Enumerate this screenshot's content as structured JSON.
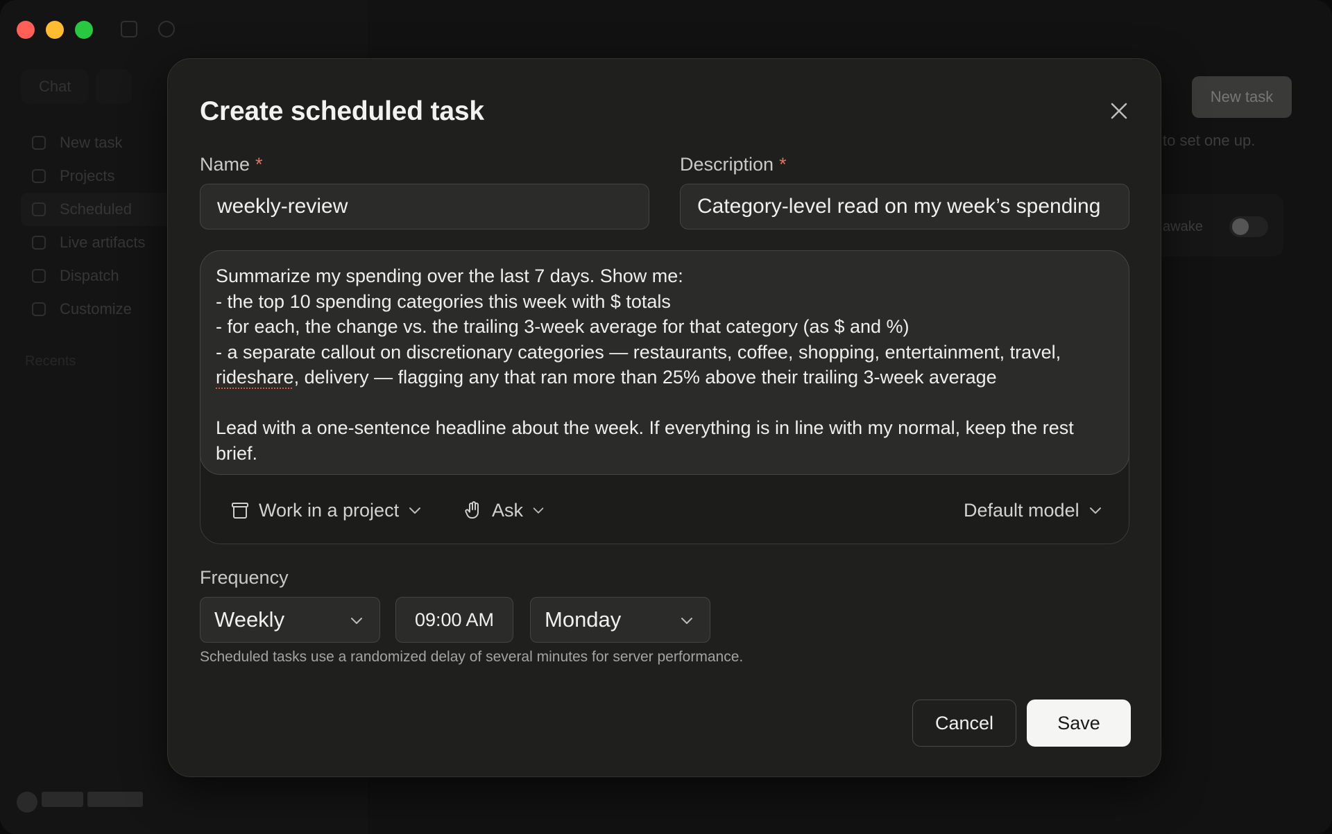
{
  "background_app": {
    "mode_tabs": [
      "Chat",
      ""
    ],
    "nav_items": [
      {
        "label": "New task",
        "icon": "plus-icon"
      },
      {
        "label": "Projects",
        "icon": "folder-icon"
      },
      {
        "label": "Scheduled",
        "icon": "clock-icon",
        "active": true
      },
      {
        "label": "Live artifacts",
        "icon": "artifact-icon"
      },
      {
        "label": "Dispatch",
        "icon": "dispatch-icon"
      },
      {
        "label": "Customize",
        "icon": "customize-icon"
      }
    ],
    "recents_label": "Recents",
    "new_task_label": "New task",
    "hint_text": "to set one up.",
    "awake_label": "awake"
  },
  "modal": {
    "title": "Create scheduled task",
    "name": {
      "label": "Name",
      "required_mark": "*",
      "value": "weekly-review"
    },
    "description": {
      "label": "Description",
      "required_mark": "*",
      "value": "Category-level read on my week’s spending"
    },
    "prompt": {
      "line1": "Summarize my spending over the last 7 days. Show me:",
      "line2": "- the top 10 spending categories this week with $ totals",
      "line3": "- for each, the change vs. the trailing 3-week average for that category (as $ and %)",
      "line4": "- a separate callout on discretionary categories — restaurants, coffee, shopping, entertainment, travel,",
      "line5_word": "rideshare",
      "line5_rest": ", delivery — flagging any that ran more than 25% above their trailing 3-week average",
      "line6": "Lead with a one-sentence headline about the week. If everything is in line with my normal, keep the rest",
      "line7": "brief."
    },
    "tools": {
      "project": "Work in a project",
      "permission": "Ask",
      "model": "Default model"
    },
    "frequency": {
      "label": "Frequency",
      "interval": "Weekly",
      "time": "09:00 AM",
      "day": "Monday",
      "helper": "Scheduled tasks use a randomized delay of several minutes for server performance."
    },
    "actions": {
      "cancel": "Cancel",
      "save": "Save"
    }
  },
  "colors": {
    "accent_required": "#e0745f",
    "modal_bg": "#1f1f1e",
    "save_bg": "#f5f5f3"
  }
}
